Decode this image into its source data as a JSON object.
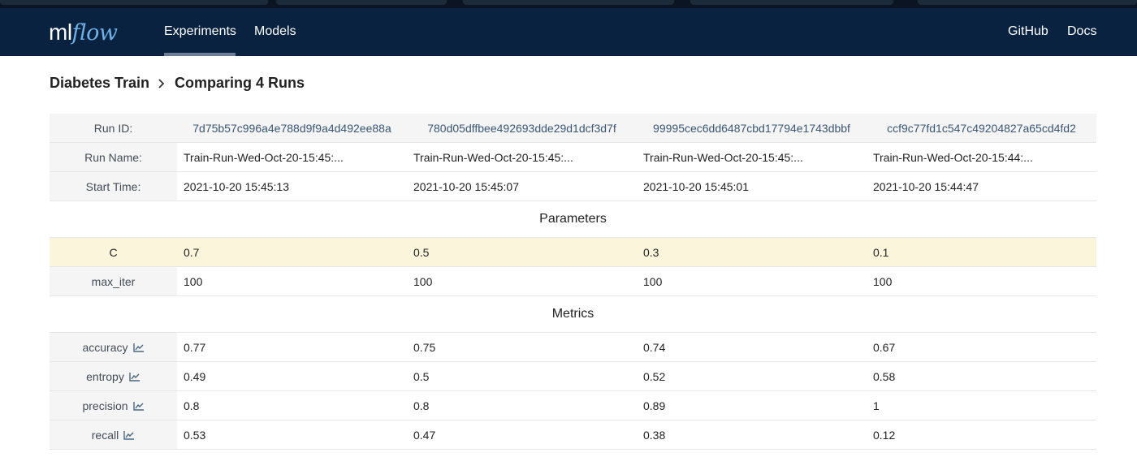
{
  "brand": {
    "ml": "ml",
    "flow": "flow"
  },
  "nav": {
    "experiments": "Experiments",
    "models": "Models",
    "github": "GitHub",
    "docs": "Docs"
  },
  "breadcrumb": {
    "experiment": "Diabetes Train",
    "page": "Comparing 4 Runs"
  },
  "run_info": {
    "run_id_label": "Run ID:",
    "run_name_label": "Run Name:",
    "start_time_label": "Start Time:",
    "runs": [
      {
        "id": "7d75b57c996a4e788d9f9a4d492ee88a",
        "name": "Train-Run-Wed-Oct-20-15:45:...",
        "start": "2021-10-20 15:45:13"
      },
      {
        "id": "780d05dffbee492693dde29d1dcf3d7f",
        "name": "Train-Run-Wed-Oct-20-15:45:...",
        "start": "2021-10-20 15:45:07"
      },
      {
        "id": "99995cec6dd6487cbd17794e1743dbbf",
        "name": "Train-Run-Wed-Oct-20-15:45:...",
        "start": "2021-10-20 15:45:01"
      },
      {
        "id": "ccf9c77fd1c547c49204827a65cd4fd2",
        "name": "Train-Run-Wed-Oct-20-15:44:...",
        "start": "2021-10-20 15:44:47"
      }
    ]
  },
  "parameters": {
    "title": "Parameters",
    "rows": [
      {
        "name": "C",
        "values": [
          "0.7",
          "0.5",
          "0.3",
          "0.1"
        ]
      },
      {
        "name": "max_iter",
        "values": [
          "100",
          "100",
          "100",
          "100"
        ]
      }
    ]
  },
  "metrics": {
    "title": "Metrics",
    "icon": "line-chart-icon",
    "rows": [
      {
        "name": "accuracy",
        "values": [
          "0.77",
          "0.75",
          "0.74",
          "0.67"
        ]
      },
      {
        "name": "entropy",
        "values": [
          "0.49",
          "0.5",
          "0.52",
          "0.58"
        ]
      },
      {
        "name": "precision",
        "values": [
          "0.8",
          "0.8",
          "0.89",
          "1"
        ]
      },
      {
        "name": "recall",
        "values": [
          "0.53",
          "0.47",
          "0.38",
          "0.12"
        ]
      }
    ]
  },
  "colors": {
    "navbar": "#082240",
    "highlight_row": "#fbf5dc",
    "label_bg": "#f5f5f5",
    "run_id_text": "#3a5672"
  }
}
